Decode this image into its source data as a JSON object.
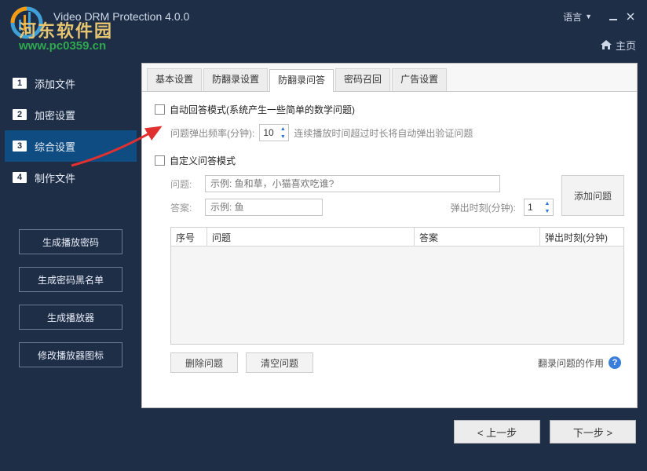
{
  "titlebar": {
    "app_title": "Video DRM Protection 4.0.0",
    "language_label": "语言"
  },
  "watermark": {
    "line1": "河东软件园",
    "line2": "www.pc0359.cn"
  },
  "home_link": "主页",
  "sidebar": {
    "steps": [
      {
        "num": "1",
        "label": "添加文件"
      },
      {
        "num": "2",
        "label": "加密设置"
      },
      {
        "num": "3",
        "label": "综合设置"
      },
      {
        "num": "4",
        "label": "制作文件"
      }
    ],
    "buttons": {
      "gen_playcode": "生成播放密码",
      "gen_blacklist": "生成密码黑名单",
      "gen_player": "生成播放器",
      "mod_icon": "修改播放器图标"
    }
  },
  "tabs": {
    "basic": "基本设置",
    "anti_record": "防翻录设置",
    "qa": "防翻录问答",
    "pwd_recall": "密码召回",
    "ads": "广告设置"
  },
  "qa_pane": {
    "auto_mode_label": "自动回答模式(系统产生一些简单的数学问题)",
    "freq_label": "问题弹出频率(分钟):",
    "freq_value": "10",
    "freq_hint": "连续播放时间超过时长将自动弹出验证问题",
    "custom_mode_label": "自定义问答模式",
    "question_label": "问题:",
    "question_placeholder": "示例: 鱼和草，小猫喜欢吃谁?",
    "answer_label": "答案:",
    "answer_placeholder": "示例: 鱼",
    "popup_time_label": "弹出时刻(分钟):",
    "popup_time_value": "1",
    "add_question": "添加问题",
    "cols": {
      "seq": "序号",
      "q": "问题",
      "a": "答案",
      "t": "弹出时刻(分钟)"
    },
    "delete_btn": "删除问题",
    "clear_btn": "清空问题",
    "help_link": "翻录问题的作用"
  },
  "footer": {
    "prev": "< 上一步",
    "next": "下一步 >"
  }
}
